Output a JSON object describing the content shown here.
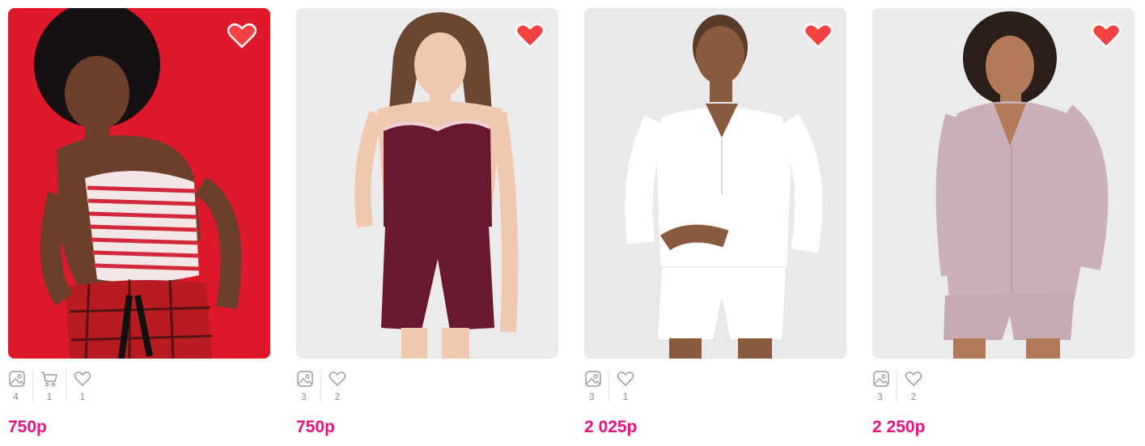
{
  "colors": {
    "price": "#e6127e",
    "heart_filled": "#f44141",
    "stat_icon": "#9a9a9a"
  },
  "products": [
    {
      "favorite_icon": "heart-outline-icon",
      "stats": {
        "photos": "4",
        "cart": "1",
        "likes": "1"
      },
      "price": "750р"
    },
    {
      "favorite_icon": "heart-filled-icon",
      "stats": {
        "photos": "3",
        "likes": "2"
      },
      "price": "750р"
    },
    {
      "favorite_icon": "heart-filled-icon",
      "stats": {
        "photos": "3",
        "likes": "1"
      },
      "price": "2 025р"
    },
    {
      "favorite_icon": "heart-filled-icon",
      "stats": {
        "photos": "3",
        "likes": "2"
      },
      "price": "2 250р"
    }
  ]
}
